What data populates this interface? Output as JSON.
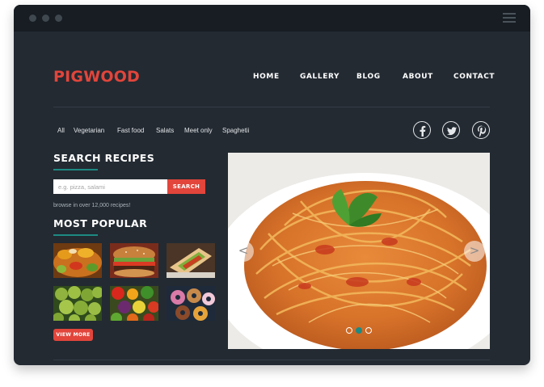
{
  "brand": {
    "logo": "PIGWOOD",
    "accent_color": "#e2453b",
    "teal_color": "#1d8a83"
  },
  "window": {
    "controls": [
      "window-dot",
      "window-dot",
      "window-dot"
    ],
    "menu_icon": "hamburger-menu-icon"
  },
  "nav": {
    "items": [
      "HOME",
      "GALLERY",
      "BLOG",
      "ABOUT",
      "CONTACT"
    ]
  },
  "filters": [
    "All",
    "Vegetarian",
    "Fast food",
    "Salats",
    "Meet only",
    "Spaghetii"
  ],
  "social": [
    "facebook-icon",
    "twitter-icon",
    "pinterest-icon"
  ],
  "search": {
    "title": "SEARCH RECIPES",
    "placeholder": "e.g. pizza, salami",
    "button_label": "SEARCH",
    "hint": "browse in over 12,000 recipes!"
  },
  "popular": {
    "title": "MOST POPULAR",
    "items": [
      "salad-photo",
      "burger-photo",
      "wrap-photo",
      "olives-photo",
      "vegetables-photo",
      "donuts-photo"
    ],
    "view_more_label": "VIEW MORE"
  },
  "slider": {
    "image": "spaghetti-photo",
    "prev_label": "<",
    "next_label": ">",
    "page_count": 3,
    "active_page": 2
  }
}
